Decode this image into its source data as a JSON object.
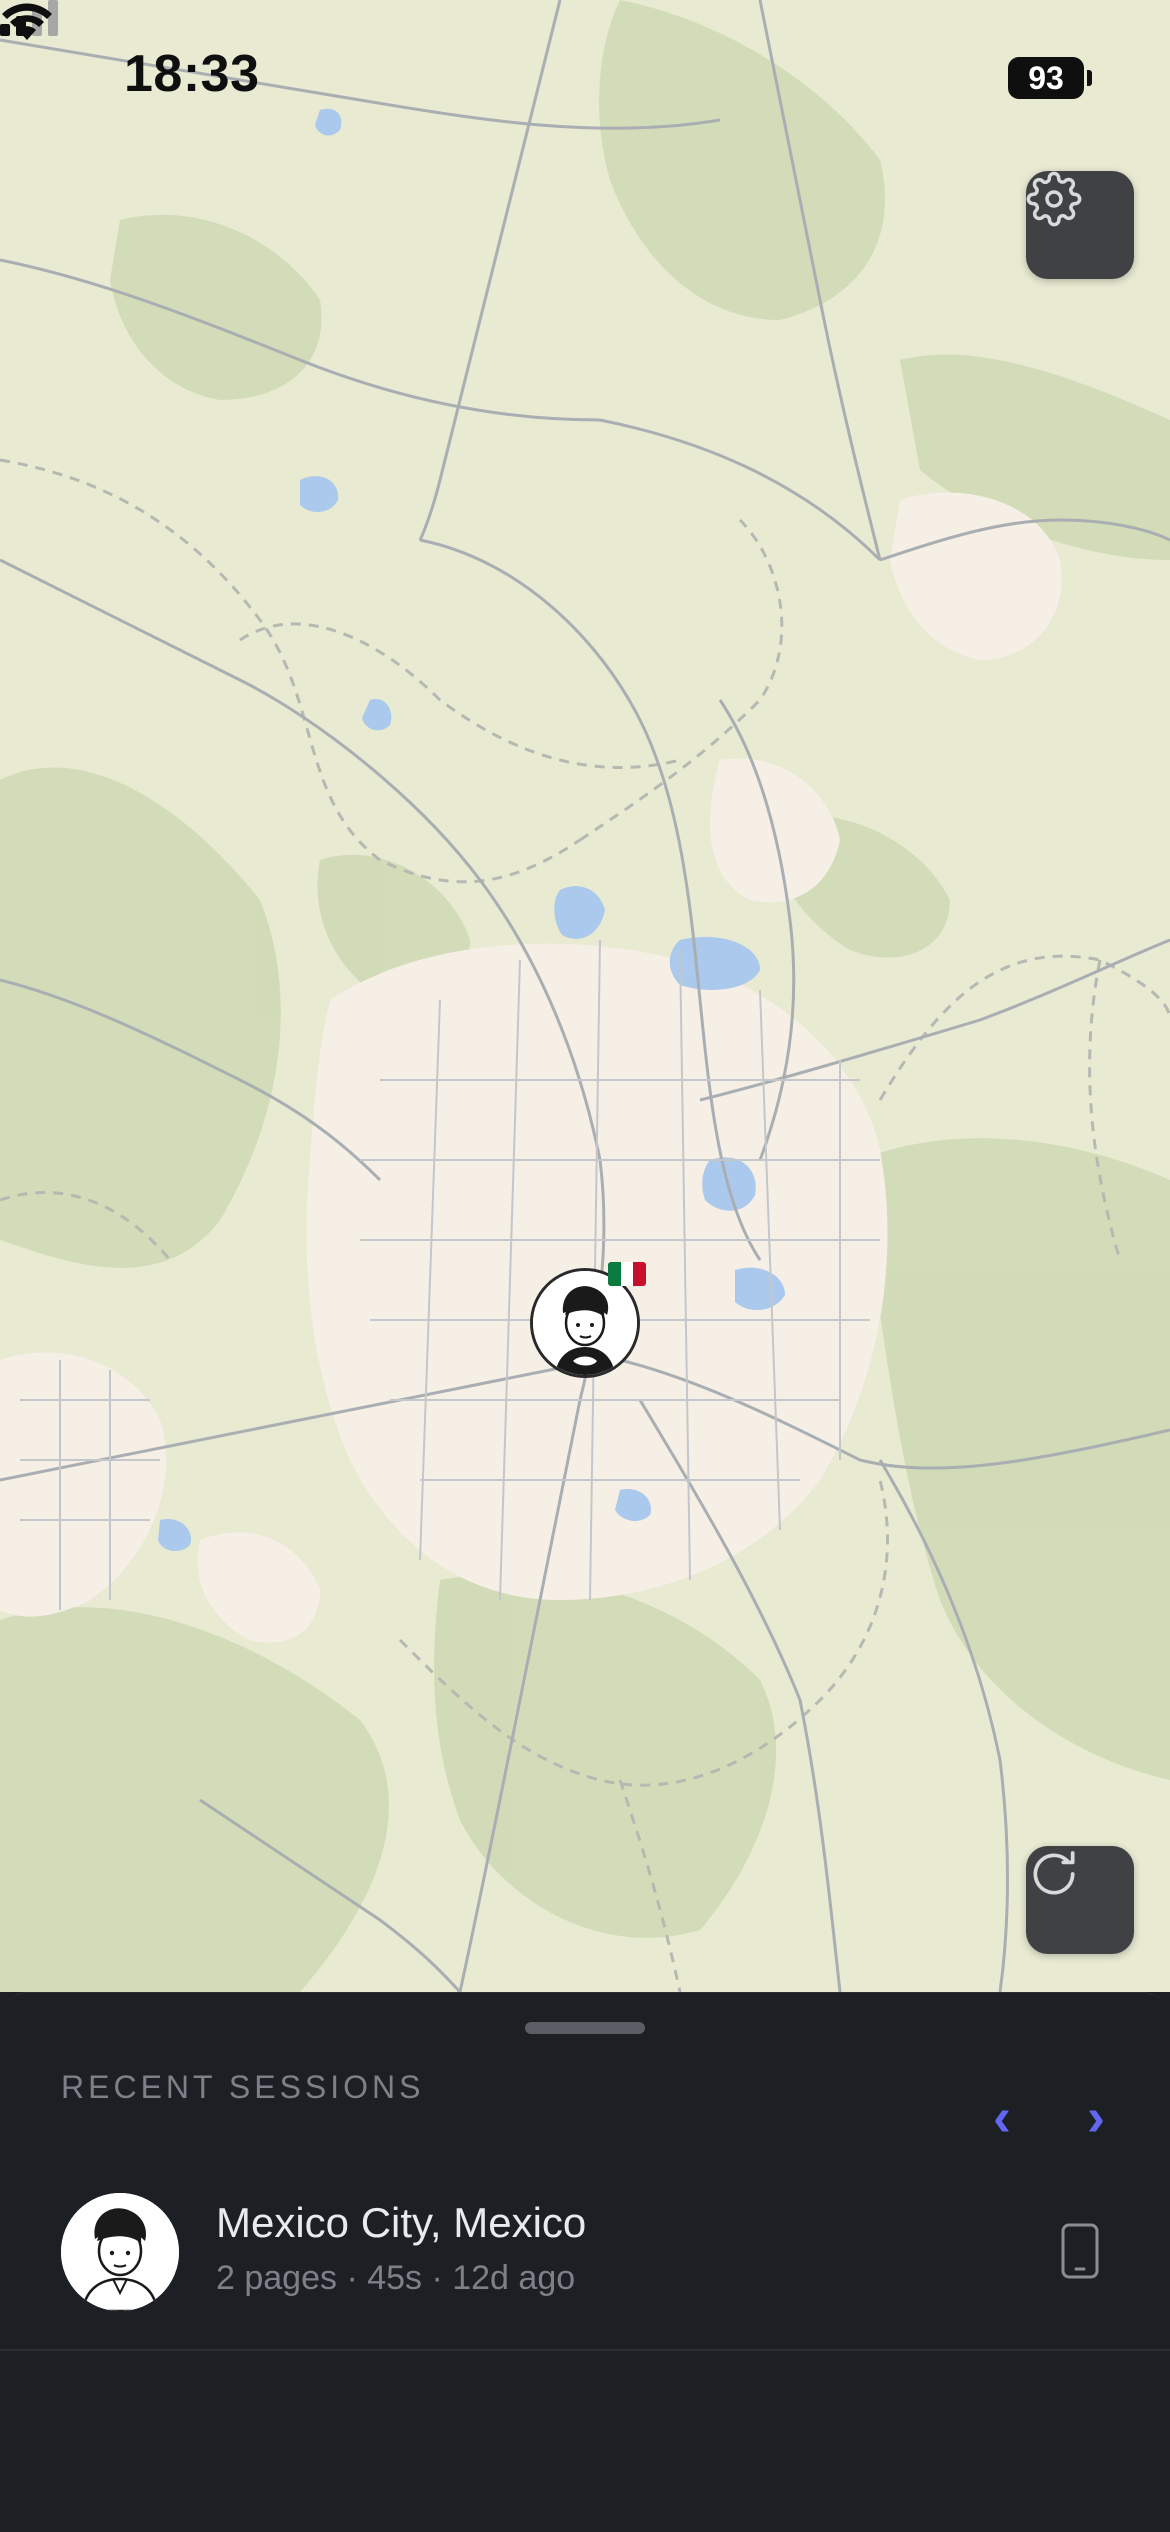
{
  "status_bar": {
    "time": "18:33",
    "battery": "93",
    "signal_icon": "cellular-signal-icon",
    "wifi_icon": "wifi-icon"
  },
  "map": {
    "settings_icon": "gear-icon",
    "refresh_icon": "refresh-icon",
    "marker_avatar": "avatar",
    "marker_flag": "mexico-flag",
    "colors": {
      "land": "#e8ead2",
      "urban": "#f6efe6",
      "forest": "#cfd9b4",
      "water": "#aac9ec",
      "road": "#a9aeb2"
    }
  },
  "sheet": {
    "title": "RECENT SESSIONS",
    "prev_icon": "‹",
    "next_icon": "›",
    "accent_color": "#6366f1",
    "sessions": [
      {
        "location": "Mexico City, Mexico",
        "meta": "2 pages · 45s · 12d ago",
        "device_icon": "phone-icon"
      }
    ]
  }
}
